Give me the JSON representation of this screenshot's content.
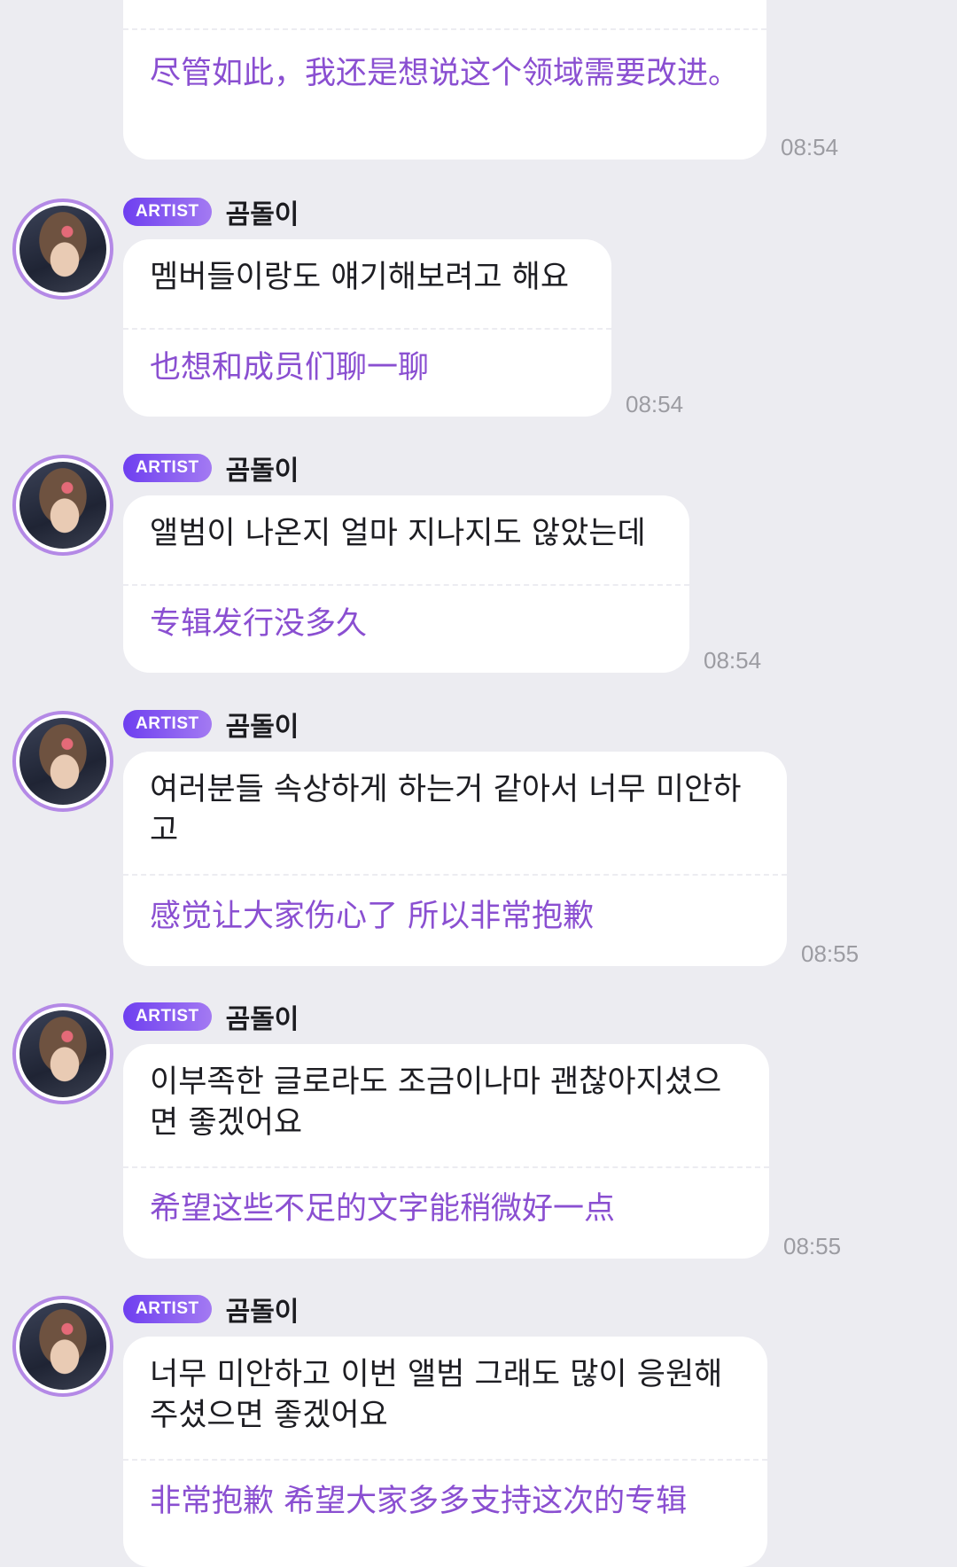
{
  "messages": [
    {
      "original": "",
      "translation": "尽管如此，我还是想说这个领域需要改进。",
      "time": "08:54"
    },
    {
      "badge": "ARTIST",
      "sender": "곰돌이",
      "original": "멤버들이랑도 얘기해보려고 해요",
      "translation": "也想和成员们聊一聊",
      "time": "08:54"
    },
    {
      "badge": "ARTIST",
      "sender": "곰돌이",
      "original": "앨범이 나온지 얼마 지나지도 않았는데",
      "translation": "专辑发行没多久",
      "time": "08:54"
    },
    {
      "badge": "ARTIST",
      "sender": "곰돌이",
      "original": "여러분들 속상하게 하는거 같아서 너무 미안하고",
      "translation": "感觉让大家伤心了 所以非常抱歉",
      "time": "08:55"
    },
    {
      "badge": "ARTIST",
      "sender": "곰돌이",
      "original": "이부족한 글로라도 조금이나마 괜찮아지셨으면 좋겠어요",
      "translation": "希望这些不足的文字能稍微好一点",
      "time": "08:55"
    },
    {
      "badge": "ARTIST",
      "sender": "곰돌이",
      "original": "너무 미안하고 이번 앨범 그래도 많이 응원해주셨으면 좋겠어요",
      "translation": "非常抱歉 希望大家多多支持这次的专辑",
      "time": ""
    }
  ]
}
